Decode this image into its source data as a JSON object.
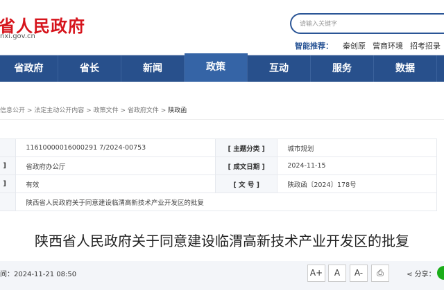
{
  "header": {
    "logo": "省人民政府",
    "domain": "nxi.gov.cn",
    "search_placeholder": "请输入关键字",
    "rec_label": "智能推荐：",
    "rec_items": [
      "秦创原",
      "营商环境",
      "招考招录"
    ]
  },
  "nav": [
    "省政府",
    "省长",
    "新闻",
    "政策",
    "互动",
    "服务",
    "数据"
  ],
  "breadcrumb": [
    "信息公开",
    "法定主动公开内容",
    "政策文件",
    "省政府文件",
    "陕政函"
  ],
  "meta": {
    "rows": [
      {
        "lbl1": "",
        "val1": "11610000016000291 7/2024-00753",
        "lbl2": "[ 主题分类 ]",
        "val2": "城市规划"
      },
      {
        "lbl1": "]",
        "val1": "省政府办公厅",
        "lbl2": "[ 成文日期 ]",
        "val2": "2024-11-15"
      },
      {
        "lbl1": "]",
        "val1": "有效",
        "lbl2": "[ 文 号 ]",
        "val2": "陕政函〔2024〕178号"
      }
    ],
    "title_value": "陕西省人民政府关于同意建设临渭高新技术产业开发区的批复"
  },
  "title": "陕西省人民政府关于同意建设临渭高新技术产业开发区的批复",
  "info": {
    "pubtime": "间：2024-11-21 08:50",
    "font_large": "A+",
    "font_normal": "A",
    "font_small": "A-",
    "share": "分享："
  }
}
